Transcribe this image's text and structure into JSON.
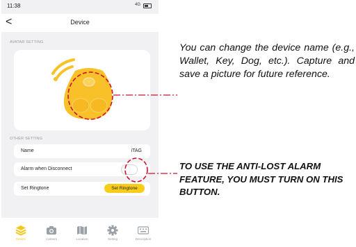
{
  "status": {
    "time": "11:38",
    "signal": "4G"
  },
  "header": {
    "back_glyph": "<",
    "title": "Device"
  },
  "avatar_section": {
    "label": "AVATAR SETTING"
  },
  "other_section": {
    "label": "OTHER SETTING",
    "name_row": {
      "label": "Name",
      "value": "iTAG"
    },
    "alarm_row": {
      "label": "Alarm when Disconnect",
      "toggle_on": false
    },
    "ringtone_row": {
      "label": "Set Ringtone",
      "button_label": "Set Ringtone"
    }
  },
  "tabbar": {
    "items": [
      {
        "label": "Device",
        "icon": "layers-icon",
        "active": true
      },
      {
        "label": "Camera",
        "icon": "camera-icon",
        "active": false
      },
      {
        "label": "Location",
        "icon": "map-icon",
        "active": false
      },
      {
        "label": "Setting",
        "icon": "gear-icon",
        "active": false
      },
      {
        "label": "Description",
        "icon": "keyboard-icon",
        "active": false
      }
    ]
  },
  "annotations": {
    "top_note": "You can change the device name (e.g., Wallet, Key, Dog, etc.). Capture and save a picture for future reference.",
    "bottom_note": "TO USE THE ANTI-LOST ALARM FEATURE, YOU MUST TURN ON THIS BUTTON."
  },
  "colors": {
    "accent": "#f5c518",
    "tag_body": "#f8c12a",
    "highlight_circle": "#d0102a",
    "screen_bg": "#f1f1f3"
  }
}
